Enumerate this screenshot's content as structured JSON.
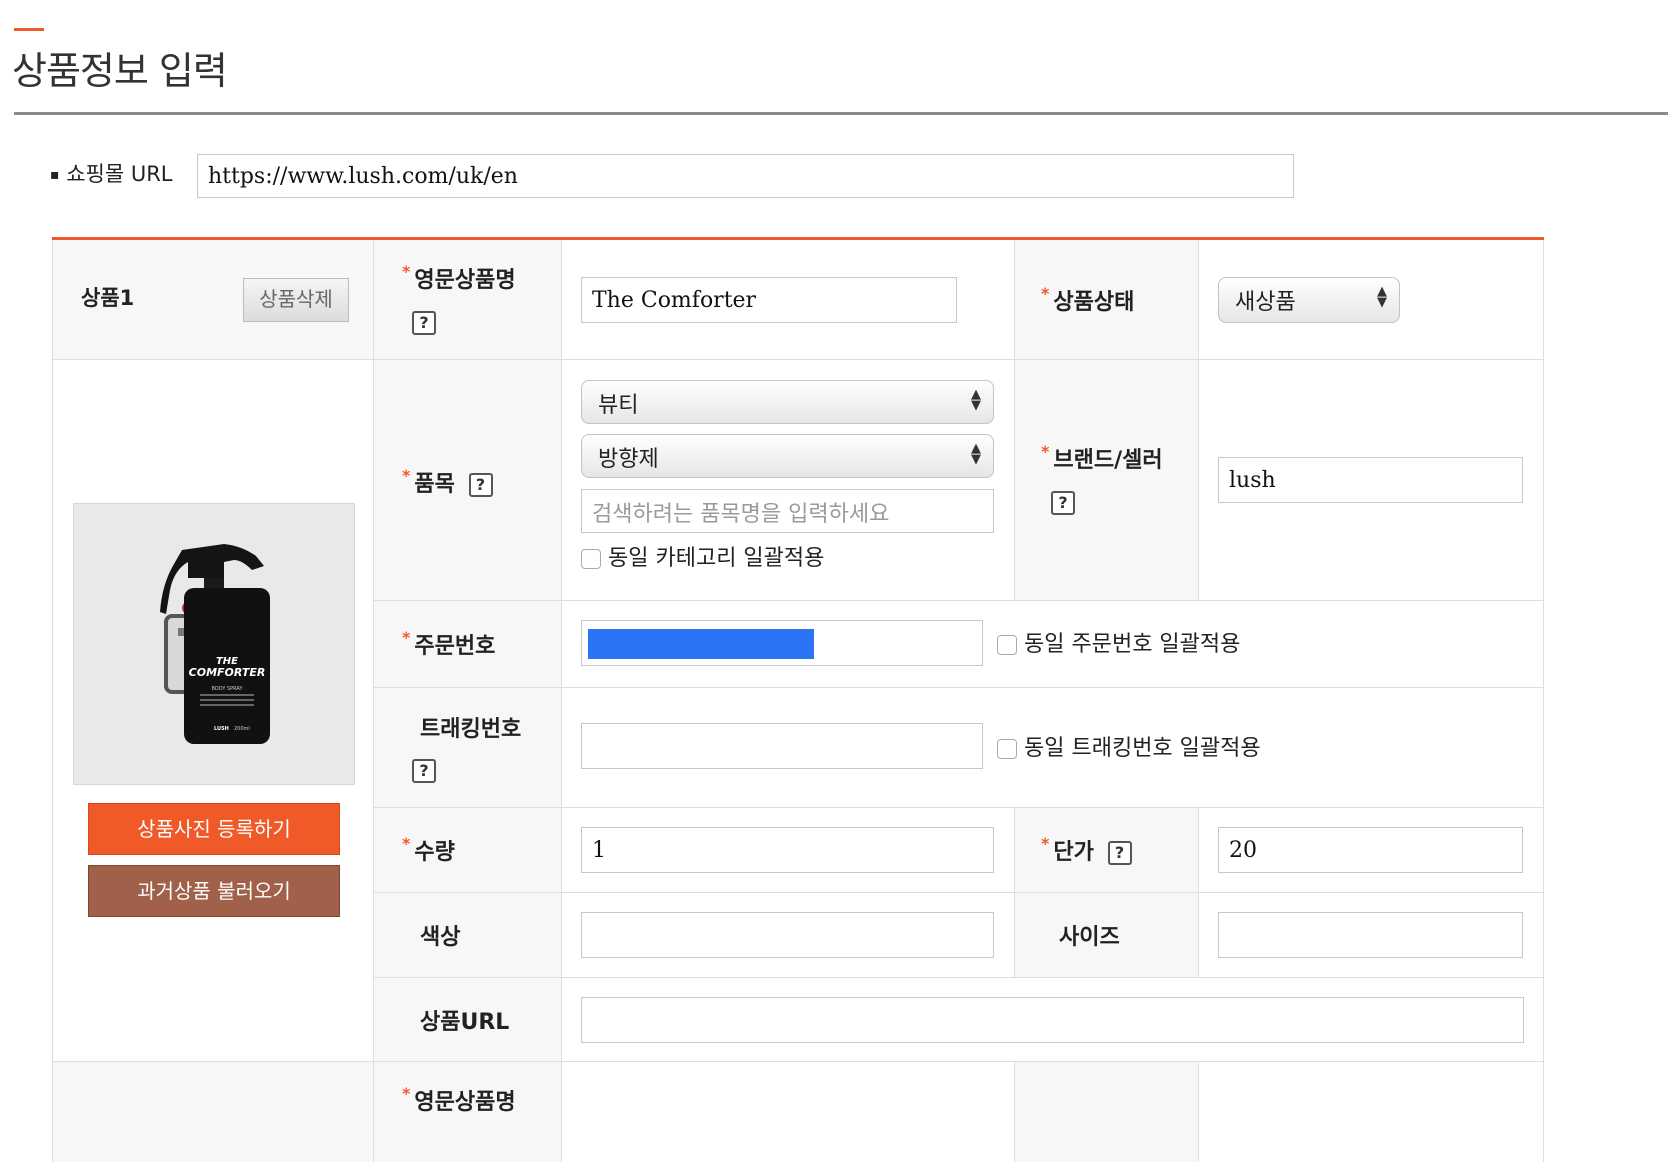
{
  "page": {
    "title": "상품정보 입력"
  },
  "shop_url": {
    "label": "쇼핑몰 URL",
    "value": "https://www.lush.com/uk/en"
  },
  "product": {
    "number_label": "상품1",
    "delete_button": "상품삭제",
    "english_name": {
      "label": "영문상품명",
      "value": "The Comforter"
    },
    "condition": {
      "label": "상품상태",
      "selected": "새상품"
    },
    "category": {
      "label": "품목",
      "selected_main": "뷰티",
      "selected_sub": "방향제",
      "search_placeholder": "검색하려는 품목명을 입력하세요",
      "apply_same_label": "동일 카테고리 일괄적용"
    },
    "brand": {
      "label": "브랜드/셀러",
      "value": "lush"
    },
    "order_number": {
      "label": "주문번호",
      "value": "",
      "apply_same_label": "동일 주문번호 일괄적용"
    },
    "tracking_number": {
      "label": "트래킹번호",
      "value": "",
      "apply_same_label": "동일 트래킹번호 일괄적용"
    },
    "quantity": {
      "label": "수량",
      "value": "1"
    },
    "unit_price": {
      "label": "단가",
      "value": "20"
    },
    "color": {
      "label": "색상",
      "value": ""
    },
    "size": {
      "label": "사이즈",
      "value": ""
    },
    "product_url": {
      "label": "상품URL",
      "value": ""
    },
    "image": {
      "bottle_text": "THE COMFORTER",
      "bottle_subtext": "BODY SPRAY",
      "bottle_brand": "LUSH",
      "bottle_volume": "200ml"
    },
    "register_photo_button": "상품사진 등록하기",
    "load_past_button": "과거상품 불러오기"
  },
  "next_product": {
    "english_name_label": "영문상품명"
  },
  "help_glyph": "?",
  "required_mark": "*",
  "colors": {
    "accent": "#f05a28",
    "secondary_button": "#a0604a",
    "redaction": "#2a74f5"
  }
}
